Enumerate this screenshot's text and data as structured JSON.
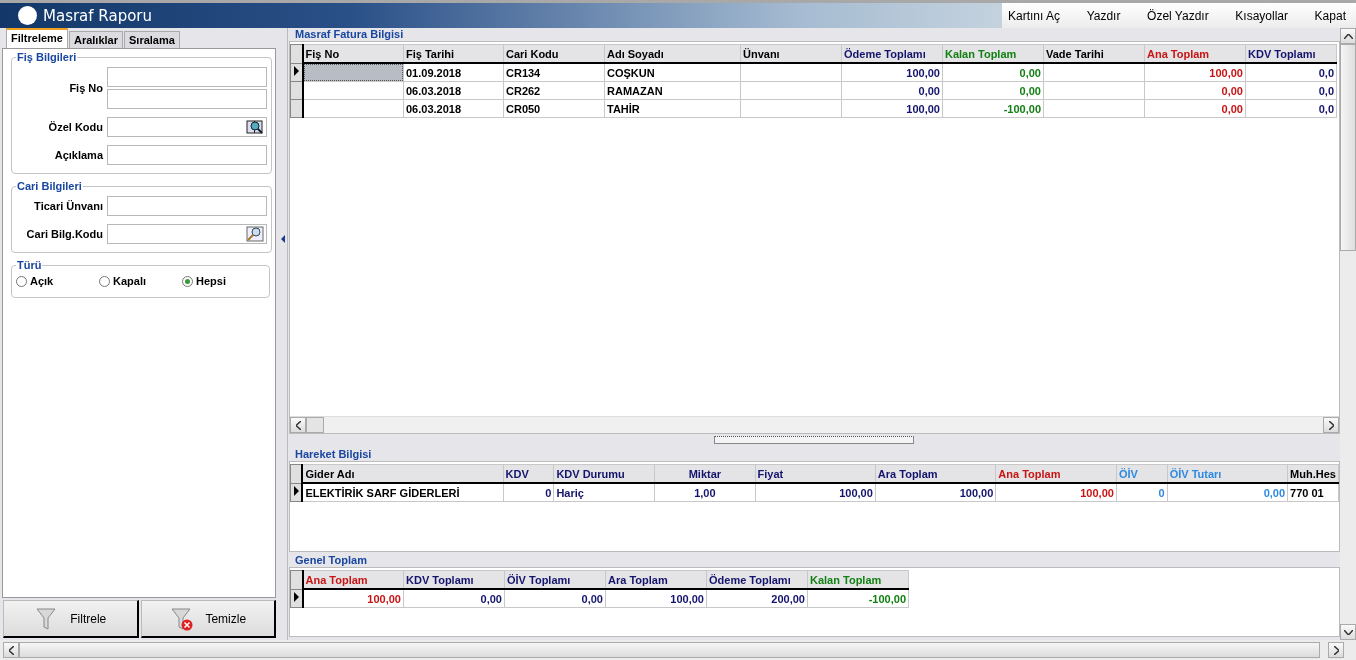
{
  "window": {
    "title": "Masraf Raporu"
  },
  "menu": [
    "Kartını Aç",
    "Yazdır",
    "Özel Yazdır",
    "Kısayollar",
    "Kapat"
  ],
  "filter_panel": {
    "tabs": [
      {
        "label": "Filtreleme",
        "selected": true
      },
      {
        "label": "Aralıklar",
        "selected": false
      },
      {
        "label": "Sıralama",
        "selected": false
      }
    ],
    "groups": [
      {
        "title": "Fiş Bilgileri",
        "fields": [
          {
            "label": "Fiş No",
            "kind": "double"
          },
          {
            "label": "Özel Kodu",
            "kind": "lookup"
          },
          {
            "label": "Açıklama",
            "kind": "text"
          }
        ]
      },
      {
        "title": "Cari Bilgileri",
        "fields": [
          {
            "label": "Ticari Ünvanı",
            "kind": "text"
          },
          {
            "label": "Cari Bilg.Kodu",
            "kind": "search"
          }
        ]
      }
    ],
    "type_group": {
      "title": "Türü",
      "options": [
        {
          "label": "Açık",
          "selected": false
        },
        {
          "label": "Kapalı",
          "selected": false
        },
        {
          "label": "Hepsi",
          "selected": true
        }
      ]
    },
    "buttons": [
      {
        "label": "Filtrele",
        "kind": "filter"
      },
      {
        "label": "Temizle",
        "kind": "clear"
      }
    ]
  },
  "invoice_grid": {
    "title": "Masraf Fatura Bilgisi",
    "columns": [
      {
        "label": "Fiş No",
        "color": "#000000",
        "kind": "text"
      },
      {
        "label": "Fiş Tarihi",
        "color": "#000000",
        "kind": "text"
      },
      {
        "label": "Cari Kodu",
        "color": "#000000",
        "kind": "text"
      },
      {
        "label": "Adı Soyadı",
        "color": "#000000",
        "kind": "text"
      },
      {
        "label": "Ünvanı",
        "color": "#000000",
        "kind": "text"
      },
      {
        "label": "Ödeme Toplamı",
        "color": "#14146e",
        "kind": "number"
      },
      {
        "label": "Kalan Toplam",
        "color": "#128012",
        "kind": "number"
      },
      {
        "label": "Vade Tarihi",
        "color": "#000000",
        "kind": "text"
      },
      {
        "label": "Ana Toplam",
        "color": "#c81414",
        "kind": "number"
      },
      {
        "label": "KDV Toplamı",
        "color": "#14146e",
        "kind": "number"
      }
    ],
    "rows": [
      {
        "selected": true,
        "cells": [
          "",
          "01.09.2018",
          "CR134",
          "COŞKUN",
          "",
          "100,00",
          "0,00",
          "",
          "100,00",
          "0,0"
        ]
      },
      {
        "selected": false,
        "cells": [
          "",
          "06.03.2018",
          "CR262",
          "RAMAZAN",
          "",
          "0,00",
          "0,00",
          "",
          "0,00",
          "0,0"
        ]
      },
      {
        "selected": false,
        "cells": [
          "",
          "06.03.2018",
          "CR050",
          "TAHİR",
          "",
          "100,00",
          "-100,00",
          "",
          "0,00",
          "0,0"
        ]
      }
    ]
  },
  "movement_grid": {
    "title": "Hareket Bilgisi",
    "columns": [
      {
        "label": "Gider Adı",
        "color": "#000000",
        "kind": "text"
      },
      {
        "label": "KDV",
        "color": "#14146e",
        "kind": "number"
      },
      {
        "label": "KDV Durumu",
        "color": "#14146e",
        "kind": "text"
      },
      {
        "label": "Miktar",
        "color": "#14146e",
        "kind": "center"
      },
      {
        "label": "Fiyat",
        "color": "#14146e",
        "kind": "number"
      },
      {
        "label": "Ara Toplam",
        "color": "#14146e",
        "kind": "number"
      },
      {
        "label": "Ana Toplam",
        "color": "#c81414",
        "kind": "number"
      },
      {
        "label": "ÖİV",
        "color": "#2e8ae0",
        "kind": "number"
      },
      {
        "label": "ÖİV Tutarı",
        "color": "#2e8ae0",
        "kind": "number"
      },
      {
        "label": "Muh.Hes",
        "color": "#000000",
        "kind": "text"
      }
    ],
    "rows": [
      {
        "selected": true,
        "cells": [
          "ELEKTİRİK SARF GİDERLERİ",
          "0",
          "Hariç",
          "1,00",
          "100,00",
          "100,00",
          "100,00",
          "0",
          "0,00",
          "770 01"
        ]
      }
    ]
  },
  "total_grid": {
    "title": "Genel Toplam",
    "columns": [
      {
        "label": "Ana Toplam",
        "color": "#c81414",
        "kind": "number"
      },
      {
        "label": "KDV Toplamı",
        "color": "#14146e",
        "kind": "number"
      },
      {
        "label": "ÖİV Toplamı",
        "color": "#14146e",
        "kind": "number"
      },
      {
        "label": "Ara Toplam",
        "color": "#14146e",
        "kind": "number"
      },
      {
        "label": "Ödeme Toplamı",
        "color": "#14146e",
        "kind": "number"
      },
      {
        "label": "Kalan Toplam",
        "color": "#128012",
        "kind": "number"
      }
    ],
    "rows": [
      {
        "selected": true,
        "cells": [
          "100,00",
          "0,00",
          "0,00",
          "100,00",
          "200,00",
          "-100,00"
        ]
      }
    ]
  }
}
